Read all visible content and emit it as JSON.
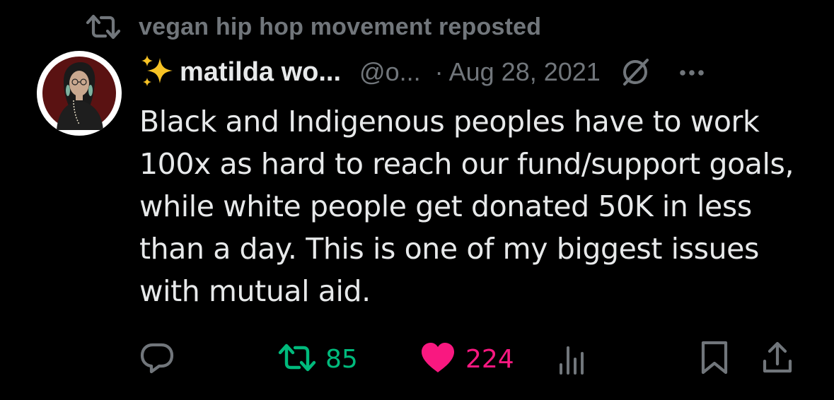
{
  "repost": {
    "icon": "repost-icon",
    "text": "vegan hip hop movement reposted"
  },
  "author": {
    "avatar": "avatar",
    "name_emoji": "sparkles-icon",
    "display_name": "matilda wo...",
    "handle": "@o...",
    "separator": "·",
    "date": "Aug 28, 2021",
    "edited_icon": "edited-icon",
    "more_icon": "more-icon"
  },
  "tweet": {
    "text": "Black and Indigenous peoples have to work 100x as hard to reach our fund/support goals, while white people get donated 50K in less than a day. This is one of my biggest issues with mutual aid."
  },
  "actions": {
    "reply_icon": "reply-icon",
    "retweet_icon": "retweet-icon",
    "retweet_count": "85",
    "like_icon": "heart-icon",
    "like_count": "224",
    "views_icon": "views-icon",
    "bookmark_icon": "bookmark-icon",
    "share_icon": "share-icon"
  },
  "colors": {
    "background": "#000000",
    "text_primary": "#e7e9ea",
    "text_secondary": "#71767b",
    "retweet_green": "#00ba7c",
    "like_pink": "#f91880",
    "sparkle_yellow": "#f7c325"
  }
}
